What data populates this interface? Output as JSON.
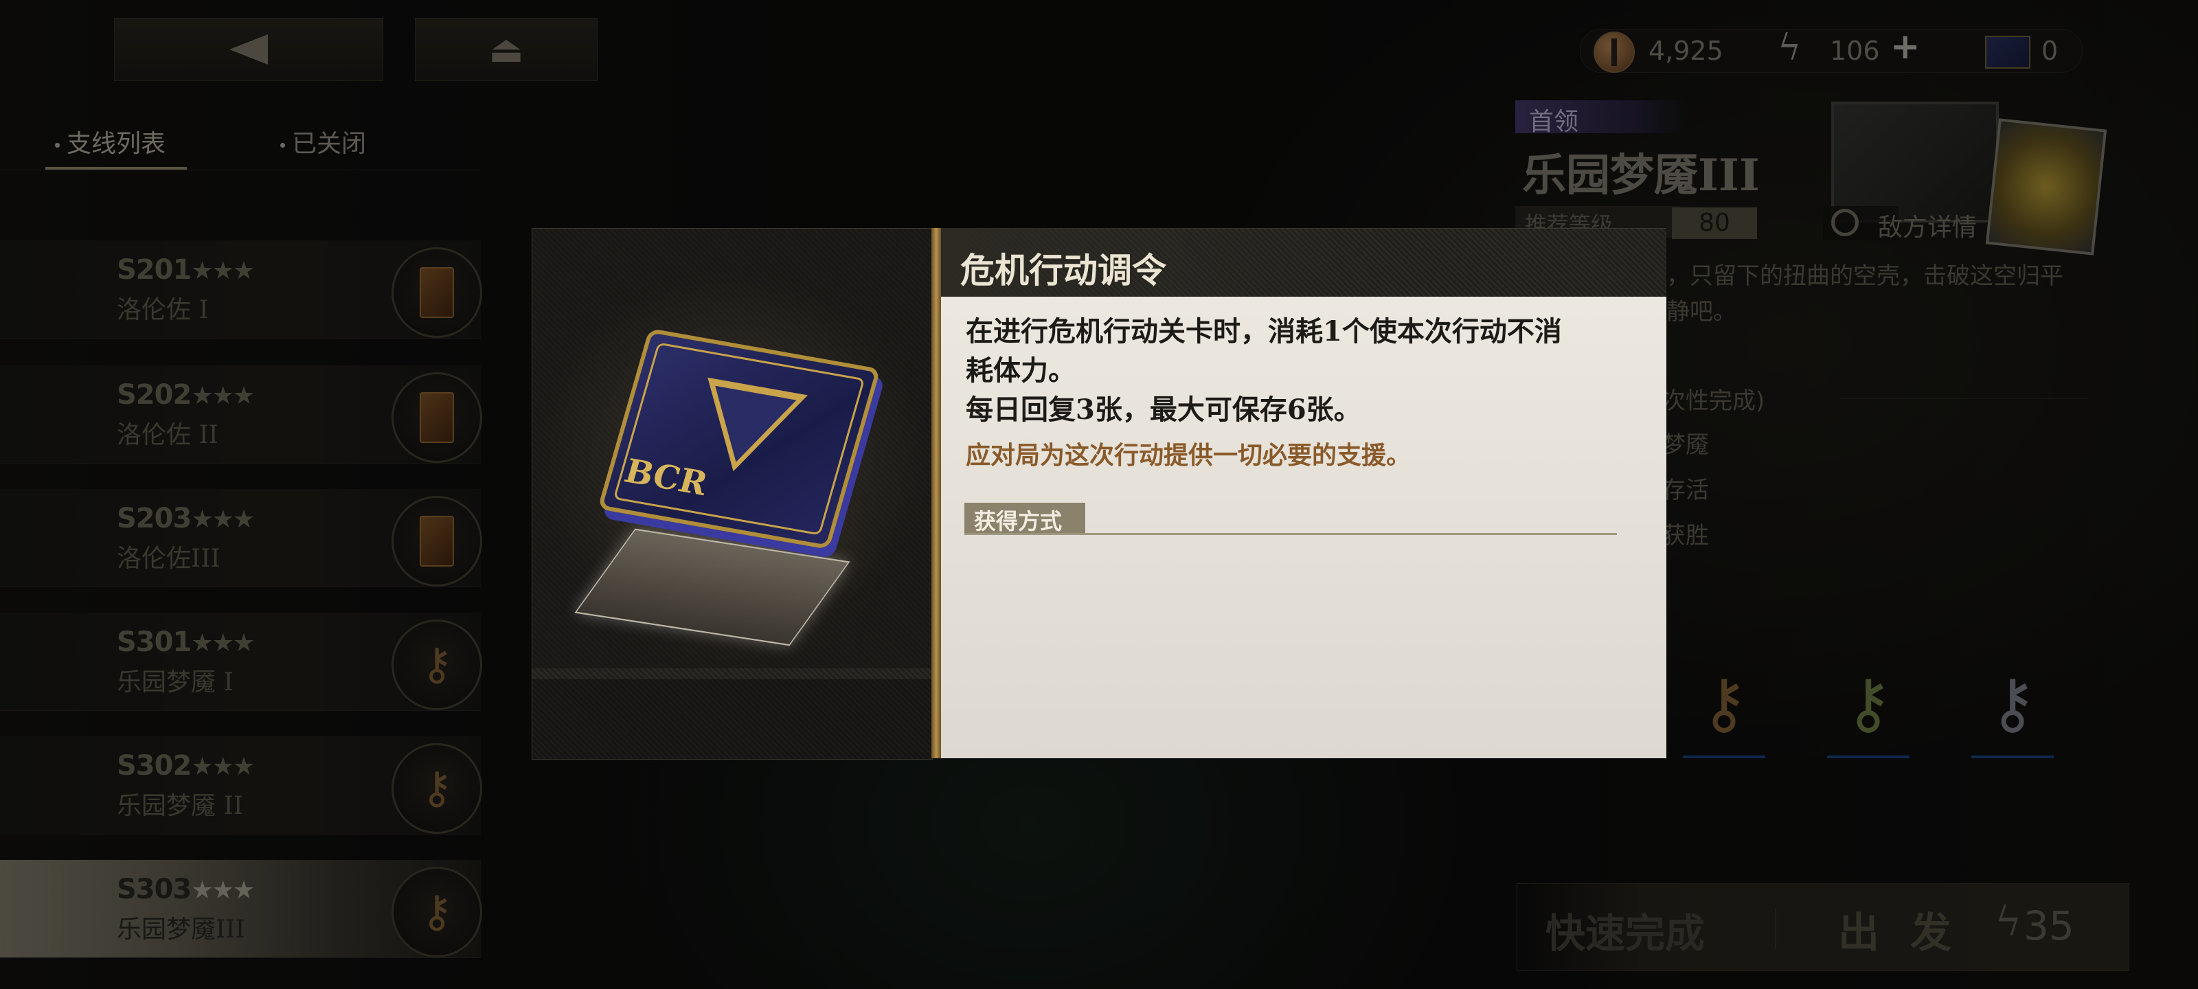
{
  "top_nav": {
    "back_icon": "back-triangle-icon",
    "home_icon": "home-icon"
  },
  "tabs": [
    {
      "label": "支线列表",
      "active": true
    },
    {
      "label": "已关闭",
      "active": false
    }
  ],
  "levels": [
    {
      "code": "S201",
      "stars": "★★★",
      "name": "洛伦佐 I",
      "icon": "book-icon"
    },
    {
      "code": "S202",
      "stars": "★★★",
      "name": "洛伦佐 II",
      "icon": "book-icon"
    },
    {
      "code": "S203",
      "stars": "★★★",
      "name": "洛伦佐III",
      "icon": "book-icon"
    },
    {
      "code": "S301",
      "stars": "★★★",
      "name": "乐园梦魇 I",
      "icon": "key-icon"
    },
    {
      "code": "S302",
      "stars": "★★★",
      "name": "乐园梦魇 II",
      "icon": "key-icon"
    },
    {
      "code": "S303",
      "stars": "★★★",
      "name": "乐园梦魇III",
      "icon": "key-icon",
      "selected": true
    }
  ],
  "resources": {
    "coins": "4,925",
    "stamina": "106",
    "stamina_plus": "+",
    "cards": "0"
  },
  "boss": {
    "tag": "首领",
    "title": "乐园梦魇III",
    "recommended_label": "推荐等级",
    "recommended_level": "80",
    "enemy_details": "敌方详情",
    "description": "，只留下的扭曲的空壳，击破这空归平静吧。",
    "objectives_header": "次性完成)",
    "objectives": [
      "梦魇",
      "存活",
      "获胜"
    ]
  },
  "actions": {
    "quick_complete": "快速完成",
    "depart": "出 发",
    "stamina_cost": "35"
  },
  "modal": {
    "title": "危机行动调令",
    "description_lines": [
      "在进行危机行动关卡时，消耗1个使本次行动不消",
      "耗体力。",
      "每日回复3张，最大可保存6张。"
    ],
    "flavor": "应对局为这次行动提供一切必要的支援。",
    "acquire_label": "获得方式",
    "card_text": "BCR"
  },
  "colors": {
    "flavor_text": "#8a5a2a",
    "divider_gold": "#b89250",
    "boss_tag": "#4a3e72"
  }
}
